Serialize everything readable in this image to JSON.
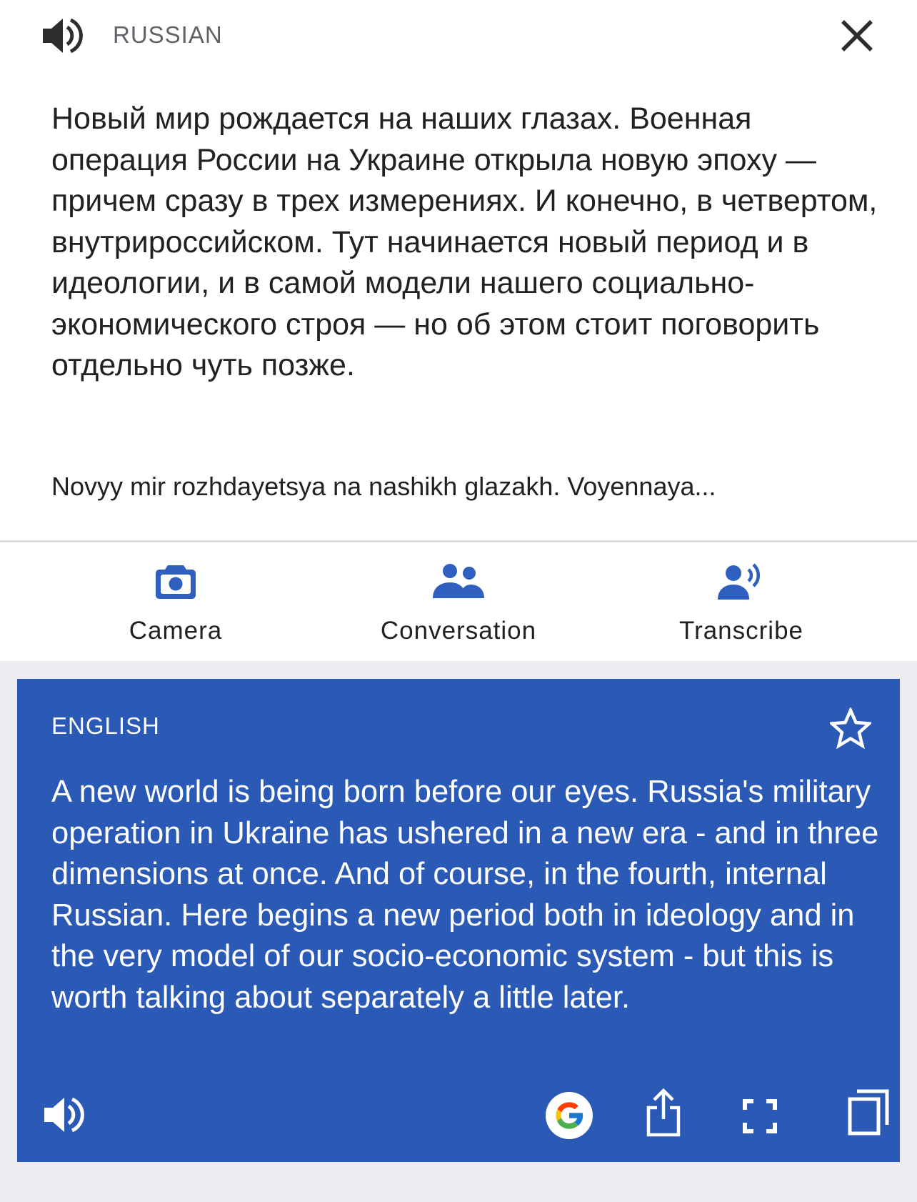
{
  "source": {
    "language_label": "RUSSIAN",
    "text": "Новый мир рождается на наших глазах. Военная операция России на Украине открыла новую эпоху — причем сразу в трех измерениях. И конечно, в четвертом, внутрироссийском. Тут начинается новый период и в идеологии, и в самой модели нашего социально-экономического строя — но об этом стоит поговорить отдельно чуть позже.",
    "transliteration": "Novyy mir rozhdayetsya na nashikh glazakh. Voyennaya...",
    "speaker_icon": "speaker-icon",
    "close_icon": "close-icon"
  },
  "toolbar": {
    "items": [
      {
        "label": "Camera",
        "icon": "camera-icon"
      },
      {
        "label": "Conversation",
        "icon": "conversation-icon"
      },
      {
        "label": "Transcribe",
        "icon": "transcribe-icon"
      }
    ]
  },
  "result": {
    "language_label": "ENGLISH",
    "text": "A new world is being born before our eyes. Russia's military operation in Ukraine has ushered in a new era - and in three dimensions at once. And of course, in the fourth, internal Russian.  Here begins a new period both in ideology and in the very model of our socio-economic system - but this is worth talking about separately a little later.",
    "icons": [
      "star-icon",
      "speaker-icon",
      "google-icon",
      "share-icon",
      "fullscreen-icon",
      "copy-icon"
    ]
  },
  "colors": {
    "accent": "#2b59b6",
    "icon_blue": "#2f5fbf",
    "page_background": "#ebebf0",
    "text": "#202124",
    "muted_text": "#5f6368"
  }
}
